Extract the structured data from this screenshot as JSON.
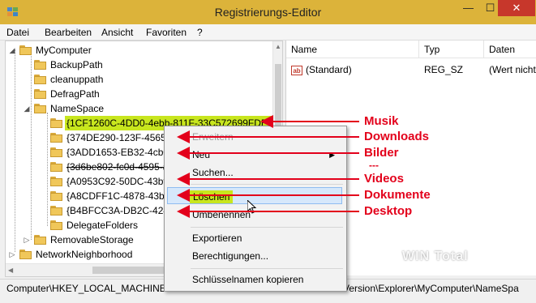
{
  "window": {
    "title": "Registrierungs-Editor",
    "minimize_glyph": "—",
    "maximize_glyph": "☐",
    "close_glyph": "✕"
  },
  "menu": [
    "Datei",
    "Bearbeiten",
    "Ansicht",
    "Favoriten",
    "?"
  ],
  "tree": {
    "root": "MyComputer",
    "children": [
      "BackupPath",
      "cleanuppath",
      "DefragPath",
      "NameSpace"
    ],
    "namespace_children": [
      "{1CF1260C-4DD0-4ebb-811F-33C572699FDE}",
      "{374DE290-123F-4565-9",
      "{3ADD1653-EB32-4cb0-",
      "{3d6be802-fc0d-4595-a",
      "{A0953C92-50DC-43bf-",
      "{A8CDFF1C-4878-43be-",
      "{B4BFCC3A-DB2C-424C",
      "DelegateFolders"
    ],
    "after": [
      "RemovableStorage"
    ],
    "sibling": "NetworkNeighborhood"
  },
  "values_pane": {
    "headers": [
      "Name",
      "Typ",
      "Daten"
    ],
    "rows": [
      {
        "icon": "ab",
        "name": "(Standard)",
        "type": "REG_SZ",
        "data": "(Wert nicht"
      }
    ]
  },
  "context_menu": {
    "items": [
      "Erweitern",
      "Neu",
      "Suchen...",
      "Löschen",
      "Umbenennen",
      "Exportieren",
      "Berechtigungen...",
      "Schlüsselnamen kopieren"
    ],
    "submenu_arrow": "▶"
  },
  "annotations": [
    "Musik",
    "Downloads",
    "Bilder",
    "Videos",
    "Dokumente",
    "Desktop"
  ],
  "annotation_dash": "---",
  "annotation_color": "#e3001b",
  "status_path": "Computer\\HKEY_LOCAL_MACHINE\\SOFTWARE\\Microsoft\\Windows\\CurrentVersion\\Explorer\\MyComputer\\NameSpa",
  "watermark": "WIN Total",
  "colors": {
    "titlebar": "#dcb33a",
    "selection": "#c8e61e",
    "close_button": "#c7372b"
  }
}
